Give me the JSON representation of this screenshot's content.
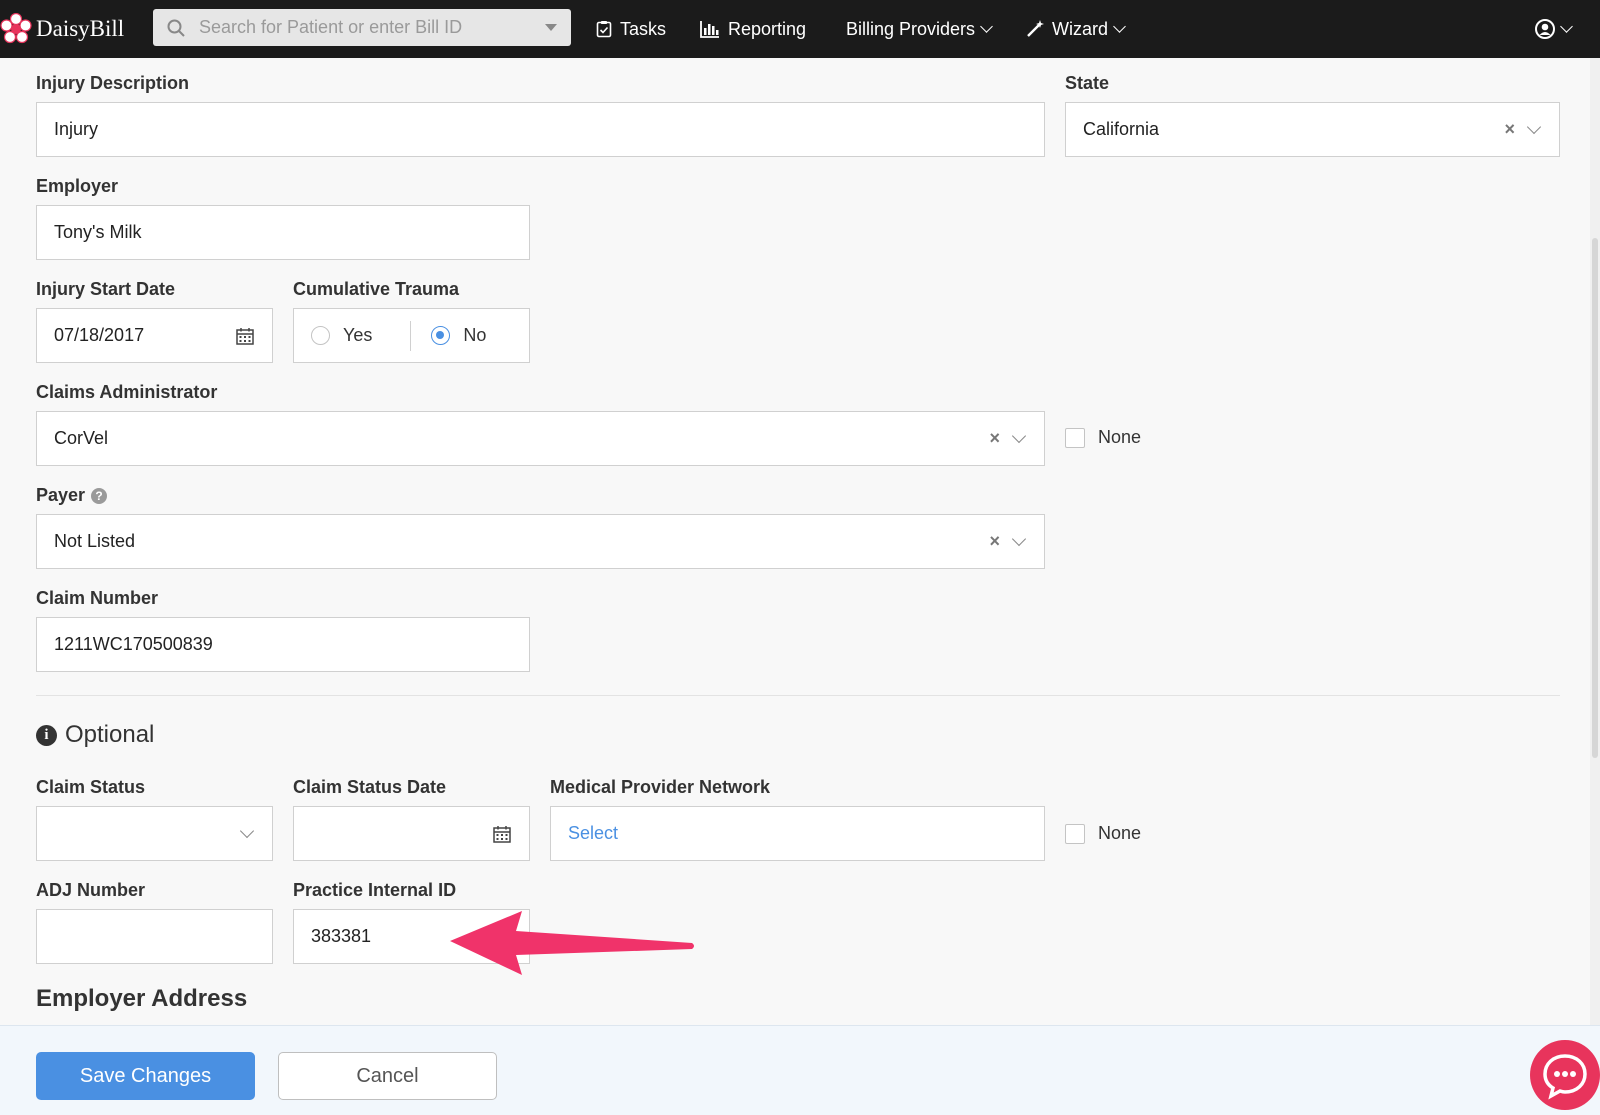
{
  "navbar": {
    "logo_text": "DaisyBill",
    "search_placeholder": "Search for Patient or enter Bill ID",
    "tasks": "Tasks",
    "reporting": "Reporting",
    "billing_providers": "Billing Providers",
    "wizard": "Wizard"
  },
  "form": {
    "injury_description": {
      "label": "Injury Description",
      "value": "Injury"
    },
    "state": {
      "label": "State",
      "value": "California"
    },
    "employer": {
      "label": "Employer",
      "value": "Tony's Milk"
    },
    "injury_start_date": {
      "label": "Injury Start Date",
      "value": "07/18/2017"
    },
    "cumulative_trauma": {
      "label": "Cumulative Trauma",
      "yes": "Yes",
      "no": "No",
      "selected": "No"
    },
    "claims_administrator": {
      "label": "Claims Administrator",
      "value": "CorVel",
      "none_label": "None"
    },
    "payer": {
      "label": "Payer",
      "value": "Not Listed"
    },
    "claim_number": {
      "label": "Claim Number",
      "value": "1211WC170500839"
    }
  },
  "optional": {
    "title": "Optional",
    "claim_status": {
      "label": "Claim Status",
      "value": ""
    },
    "claim_status_date": {
      "label": "Claim Status Date",
      "value": ""
    },
    "medical_provider_network": {
      "label": "Medical Provider Network",
      "value": "Select",
      "none_label": "None"
    },
    "adj_number": {
      "label": "ADJ Number",
      "value": ""
    },
    "practice_internal_id": {
      "label": "Practice Internal ID",
      "value": "383381"
    }
  },
  "employer_address_title": "Employer Address",
  "footer": {
    "save": "Save Changes",
    "cancel": "Cancel"
  },
  "colors": {
    "accent": "#4a90e2",
    "annotation_arrow": "#f0336a",
    "navbar": "#1b1b1b",
    "chat": "#e8345c"
  }
}
